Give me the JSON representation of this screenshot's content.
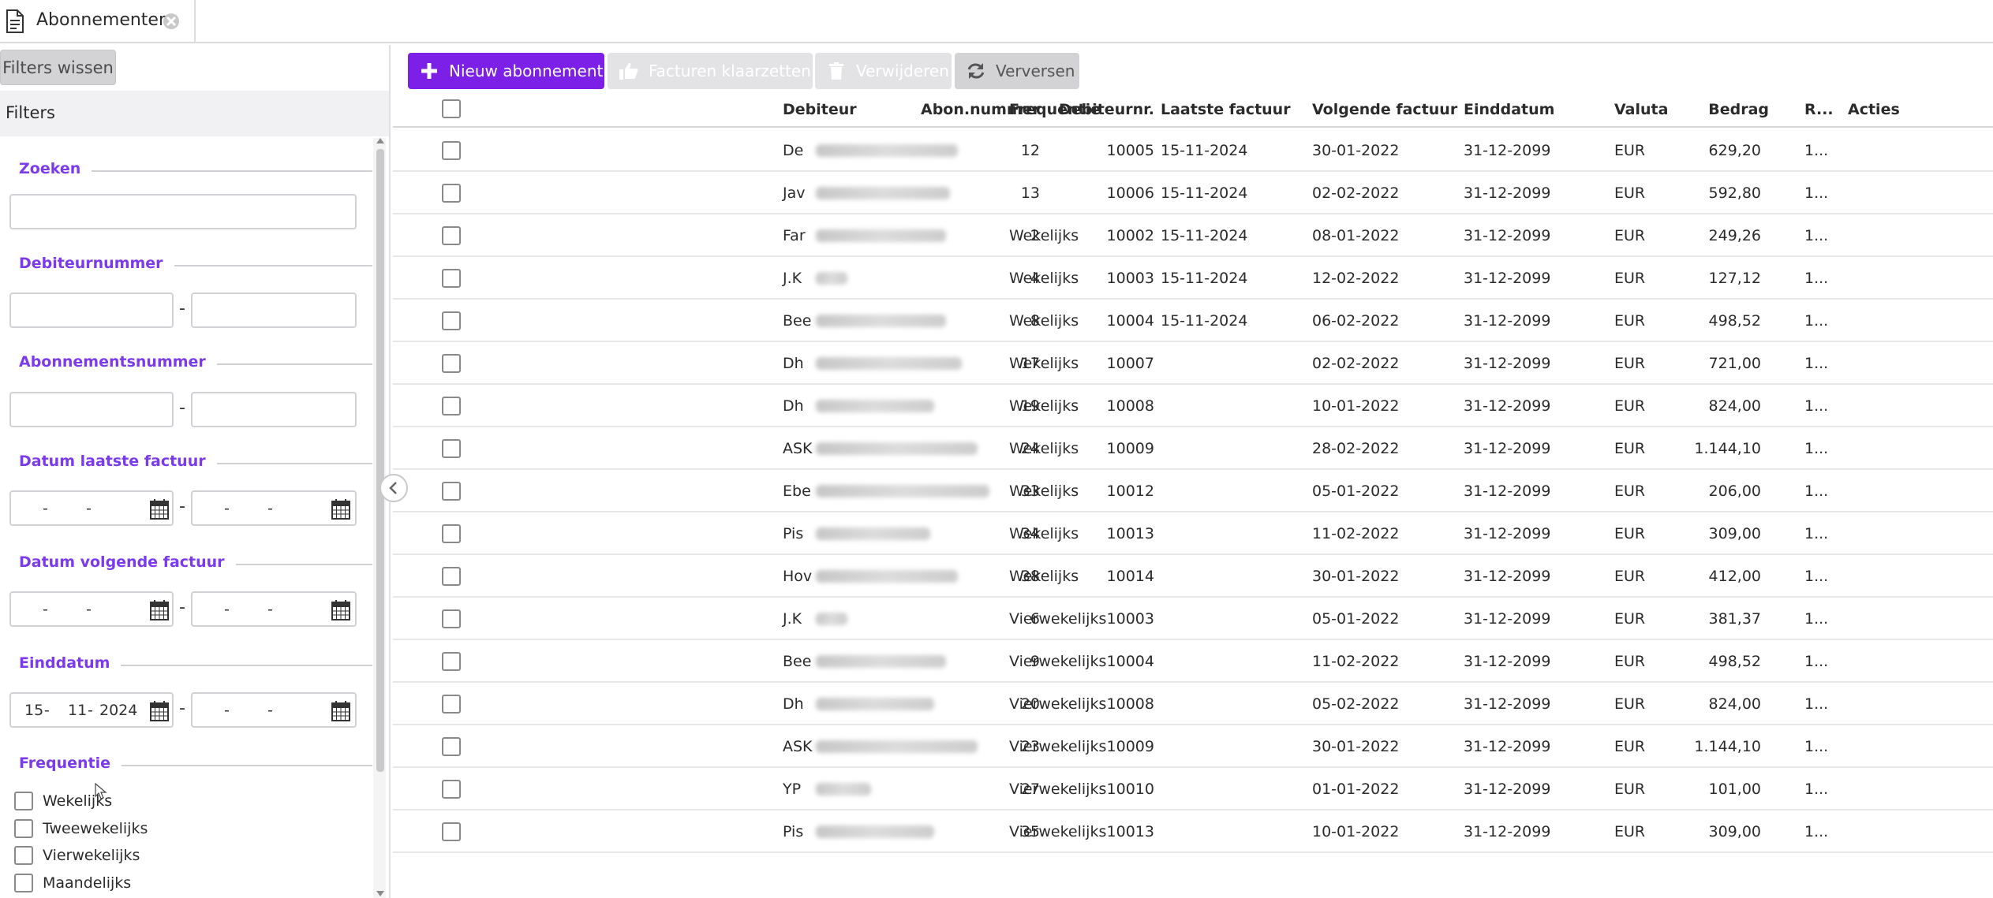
{
  "tab": {
    "title": "Abonnementen",
    "doc_icon": "document-icon",
    "close_icon": "close-icon"
  },
  "sidebar": {
    "clear_button": "Filters wissen",
    "filters_header": "Filters",
    "sections": {
      "search": "Zoeken",
      "debtor_number": "Debiteurnummer",
      "subscription_number": "Abonnementsnummer",
      "last_invoice_date": "Datum laatste factuur",
      "next_invoice_date": "Datum volgende factuur",
      "end_date": "Einddatum",
      "frequency": "Frequentie"
    },
    "search_value": "",
    "range_separator": "-",
    "empty_date": {
      "sep1": "-",
      "sep2": "-"
    },
    "end_date_from": {
      "day": "15",
      "month": "11",
      "year": "2024",
      "sep1": "-",
      "sep2": "-"
    },
    "frequency_options": [
      "Wekelijks",
      "Tweewekelijks",
      "Vierwekelijks",
      "Maandelijks"
    ]
  },
  "toolbar": {
    "new": "Nieuw abonnement",
    "finalize": "Facturen klaarzetten",
    "delete": "Verwijderen",
    "refresh": "Verversen"
  },
  "colors": {
    "accent": "#7c20e8",
    "section_title": "#7c3aed",
    "disabled_button": "#e3e3e6",
    "neutral_button": "#d3d3d6"
  },
  "table": {
    "columns": {
      "sub_number": "Abon.nummer",
      "debtor_number": "Debiteurnr.",
      "debtor": "Debiteur",
      "frequency": "Frequentie",
      "last_invoice": "Laatste factuur",
      "next_invoice": "Volgende factuur",
      "end_date": "Einddatum",
      "currency": "Valuta",
      "amount": "Bedrag",
      "r": "R...",
      "actions": "Acties"
    },
    "rows": [
      {
        "sub": "12",
        "debnr": "10005",
        "debtor": "De",
        "freq": "",
        "last": "15-11-2024",
        "next": "30-01-2022",
        "end": "31-12-2099",
        "cur": "EUR",
        "amount": "629,20",
        "r": "1..."
      },
      {
        "sub": "13",
        "debnr": "10006",
        "debtor": "Jav",
        "freq": "",
        "last": "15-11-2024",
        "next": "02-02-2022",
        "end": "31-12-2099",
        "cur": "EUR",
        "amount": "592,80",
        "r": "1..."
      },
      {
        "sub": "2",
        "debnr": "10002",
        "debtor": "Far",
        "freq": "Wekelijks",
        "last": "15-11-2024",
        "next": "08-01-2022",
        "end": "31-12-2099",
        "cur": "EUR",
        "amount": "249,26",
        "r": "1..."
      },
      {
        "sub": "4",
        "debnr": "10003",
        "debtor": "J.K",
        "freq": "Wekelijks",
        "last": "15-11-2024",
        "next": "12-02-2022",
        "end": "31-12-2099",
        "cur": "EUR",
        "amount": "127,12",
        "r": "1..."
      },
      {
        "sub": "8",
        "debnr": "10004",
        "debtor": "Bee",
        "freq": "Wekelijks",
        "last": "15-11-2024",
        "next": "06-02-2022",
        "end": "31-12-2099",
        "cur": "EUR",
        "amount": "498,52",
        "r": "1..."
      },
      {
        "sub": "17",
        "debnr": "10007",
        "debtor": "Dh",
        "freq": "Wekelijks",
        "last": "",
        "next": "02-02-2022",
        "end": "31-12-2099",
        "cur": "EUR",
        "amount": "721,00",
        "r": "1..."
      },
      {
        "sub": "19",
        "debnr": "10008",
        "debtor": "Dh",
        "freq": "Wekelijks",
        "last": "",
        "next": "10-01-2022",
        "end": "31-12-2099",
        "cur": "EUR",
        "amount": "824,00",
        "r": "1..."
      },
      {
        "sub": "24",
        "debnr": "10009",
        "debtor": "ASK",
        "freq": "Wekelijks",
        "last": "",
        "next": "28-02-2022",
        "end": "31-12-2099",
        "cur": "EUR",
        "amount": "1.144,10",
        "r": "1..."
      },
      {
        "sub": "33",
        "debnr": "10012",
        "debtor": "Ebe",
        "freq": "Wekelijks",
        "last": "",
        "next": "05-01-2022",
        "end": "31-12-2099",
        "cur": "EUR",
        "amount": "206,00",
        "r": "1..."
      },
      {
        "sub": "34",
        "debnr": "10013",
        "debtor": "Pis",
        "freq": "Wekelijks",
        "last": "",
        "next": "11-02-2022",
        "end": "31-12-2099",
        "cur": "EUR",
        "amount": "309,00",
        "r": "1..."
      },
      {
        "sub": "38",
        "debnr": "10014",
        "debtor": "Hov",
        "freq": "Wekelijks",
        "last": "",
        "next": "30-01-2022",
        "end": "31-12-2099",
        "cur": "EUR",
        "amount": "412,00",
        "r": "1..."
      },
      {
        "sub": "6",
        "debnr": "10003",
        "debtor": "J.K",
        "freq": "Vierwekelijks",
        "last": "",
        "next": "05-01-2022",
        "end": "31-12-2099",
        "cur": "EUR",
        "amount": "381,37",
        "r": "1..."
      },
      {
        "sub": "9",
        "debnr": "10004",
        "debtor": "Bee",
        "freq": "Vierwekelijks",
        "last": "",
        "next": "11-02-2022",
        "end": "31-12-2099",
        "cur": "EUR",
        "amount": "498,52",
        "r": "1..."
      },
      {
        "sub": "20",
        "debnr": "10008",
        "debtor": "Dh",
        "freq": "Vierwekelijks",
        "last": "",
        "next": "05-02-2022",
        "end": "31-12-2099",
        "cur": "EUR",
        "amount": "824,00",
        "r": "1..."
      },
      {
        "sub": "23",
        "debnr": "10009",
        "debtor": "ASK",
        "freq": "Vierwekelijks",
        "last": "",
        "next": "30-01-2022",
        "end": "31-12-2099",
        "cur": "EUR",
        "amount": "1.144,10",
        "r": "1..."
      },
      {
        "sub": "27",
        "debnr": "10010",
        "debtor": "YP",
        "freq": "Vierwekelijks",
        "last": "",
        "next": "01-01-2022",
        "end": "31-12-2099",
        "cur": "EUR",
        "amount": "101,00",
        "r": "1..."
      },
      {
        "sub": "35",
        "debnr": "10013",
        "debtor": "Pis",
        "freq": "Vierwekelijks",
        "last": "",
        "next": "10-01-2022",
        "end": "31-12-2099",
        "cur": "EUR",
        "amount": "309,00",
        "r": "1..."
      }
    ]
  }
}
